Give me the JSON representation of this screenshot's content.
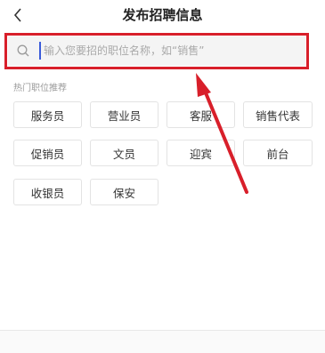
{
  "header": {
    "title": "发布招聘信息",
    "back_icon": "chevron-left-icon"
  },
  "search": {
    "placeholder": "输入您要招的职位名称，如“销售”",
    "icon": "search-icon"
  },
  "hot_positions": {
    "label": "热门职位推荐",
    "items": [
      "服务员",
      "营业员",
      "客服",
      "销售代表",
      "促销员",
      "文员",
      "迎宾",
      "前台",
      "收银员",
      "保安"
    ]
  },
  "annotation": {
    "color": "#d81f2a"
  }
}
